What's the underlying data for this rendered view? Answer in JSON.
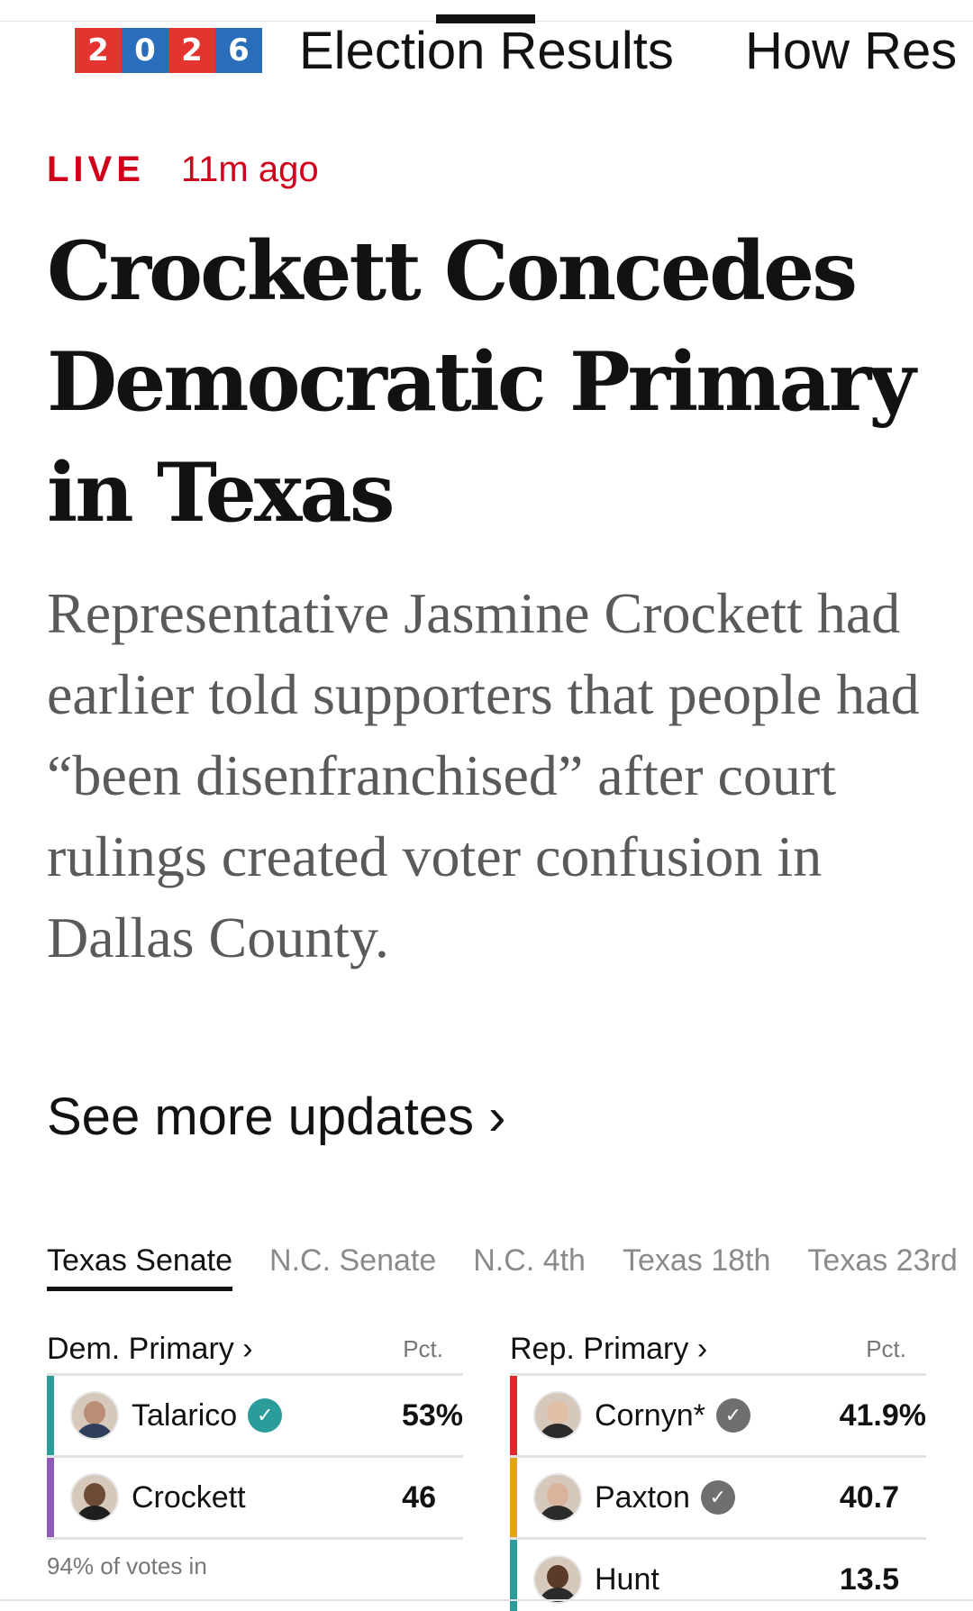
{
  "nav": {
    "year_digits": [
      {
        "digit": "2",
        "color": "#e3342f"
      },
      {
        "digit": "0",
        "color": "#2a6ebb"
      },
      {
        "digit": "2",
        "color": "#e3342f"
      },
      {
        "digit": "6",
        "color": "#2a6ebb"
      }
    ],
    "links": [
      "Election Results",
      "How Res"
    ]
  },
  "article": {
    "live_label": "LIVE",
    "timestamp": "11m ago",
    "headline": "Crockett Concedes Democratic Primary in Texas",
    "summary": "Representative Jasmine Crockett had earlier told supporters that people had “been disenfranchised” after court rulings created voter confusion in Dallas County.",
    "more_link": "See more updates ›"
  },
  "race_tabs": [
    {
      "label": "Texas Senate",
      "active": true
    },
    {
      "label": "N.C. Senate",
      "active": false
    },
    {
      "label": "N.C. 4th",
      "active": false
    },
    {
      "label": "Texas 18th",
      "active": false
    },
    {
      "label": "Texas 23rd",
      "active": false
    }
  ],
  "dem_primary": {
    "title": "Dem. Primary ›",
    "pct_label": "Pct.",
    "candidates": [
      {
        "name": "Talarico",
        "pct": "53%",
        "bar_color": "#2a9d9a",
        "check": "#2a9d9a"
      },
      {
        "name": "Crockett",
        "pct": "46",
        "bar_color": "#8e5ab5",
        "check": null
      }
    ],
    "votes_in": "94% of votes in"
  },
  "rep_primary": {
    "title": "Rep. Primary ›",
    "pct_label": "Pct.",
    "candidates": [
      {
        "name": "Cornyn*",
        "pct": "41.9%",
        "bar_color": "#d62d2d",
        "check": "#6f6f6f"
      },
      {
        "name": "Paxton",
        "pct": "40.7",
        "bar_color": "#e3a21a",
        "check": "#6f6f6f"
      },
      {
        "name": "Hunt",
        "pct": "13.5",
        "bar_color": "#2a9d9a",
        "check": null
      }
    ]
  }
}
